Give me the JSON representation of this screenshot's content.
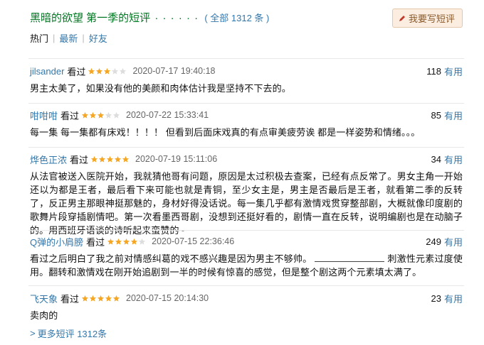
{
  "header": {
    "title": "黑暗的欲望 第一季的短评",
    "dots": "· · · · · ·",
    "count_text": "( 全部 1312 条 )",
    "write_button": "我要写短评"
  },
  "tabs": [
    {
      "label": "热门",
      "active": true
    },
    {
      "label": "最新",
      "active": false
    },
    {
      "label": "好友",
      "active": false
    }
  ],
  "reviews": [
    {
      "author": "jilsander",
      "status": "看过",
      "rating": 3,
      "date": "2020-07-17 19:40:18",
      "votes": "118",
      "useful_label": "有用",
      "content": "男主太美了，如果没有他的美颜和肉体估计我是坚持不下去的。"
    },
    {
      "author": "咁咁咁",
      "status": "看过",
      "rating": 3,
      "date": "2020-07-22 15:33:41",
      "votes": "85",
      "useful_label": "有用",
      "content": "每一集 每一集都有床戏！！！！ 但看到后面床戏真的有点审美疲劳诶 都是一样姿势和情绪。。。"
    },
    {
      "author": "烨色正浓",
      "status": "看过",
      "rating": 5,
      "date": "2020-07-19 15:11:06",
      "votes": "34",
      "useful_label": "有用",
      "content": "从法官被送入医院开始，我就猜他哥有问题，原因是太过积极去查案，已经有点反常了。男女主角一开始还以为都是王者，最后看下来可能也就是青铜，至少女主是，男主是否最后是王者，就看第二季的反转了，反正男主那眼神挺那魅的，身材好得没话说。每一集几乎都有激情戏贯穿整部剧，大概就像印度剧的歌舞片段穿插剧情吧。第一次看墨西哥剧，没想到还挺好看的，剧情一直在反转，说明编剧也是在动脑子的。用西班牙语谈的诗听起来蛮赞的~"
    },
    {
      "author": "Q弹的小肩膀",
      "status": "看过",
      "rating": 4,
      "date": "2020-07-15 22:36:46",
      "votes": "249",
      "useful_label": "有用",
      "content_before": "看过之后明白了我之前对情感纠葛的戏不感兴趣是因为男主不够帅。",
      "content_after": "刺激性元素过度使用。翻转和激情戏在刚开始追剧到一半的时候有惊喜的感觉，但是整个剧这两个元素填太满了。"
    },
    {
      "author": "飞天象",
      "status": "看过",
      "rating": 5,
      "date": "2020-07-15 20:14:30",
      "votes": "23",
      "useful_label": "有用",
      "content": "卖肉的"
    }
  ],
  "more_link": "更多短评 1312条",
  "more_arrow": ">",
  "colors": {
    "title_green": "#007722",
    "link_blue": "#3377aa",
    "star_gold": "#f5a623",
    "star_empty": "#dddddd",
    "button_bg": "#fbeee1"
  }
}
